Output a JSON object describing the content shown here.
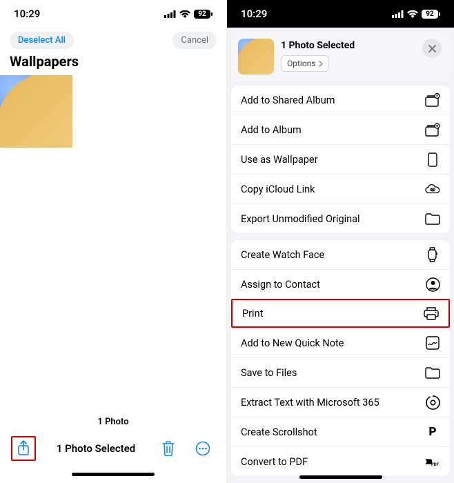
{
  "status": {
    "time": "10:29",
    "battery": "92"
  },
  "left": {
    "deselect": "Deselect All",
    "cancel": "Cancel",
    "title": "Wallpapers",
    "count": "1 Photo",
    "selected": "1 Photo Selected"
  },
  "right": {
    "title": "1 Photo Selected",
    "options": "Options",
    "group1": [
      {
        "label": "Add to Shared Album"
      },
      {
        "label": "Add to Album"
      },
      {
        "label": "Use as Wallpaper"
      },
      {
        "label": "Copy iCloud Link"
      },
      {
        "label": "Export Unmodified Original"
      }
    ],
    "group2": [
      {
        "label": "Create Watch Face"
      },
      {
        "label": "Assign to Contact"
      },
      {
        "label": "Print"
      },
      {
        "label": "Add to New Quick Note"
      },
      {
        "label": "Save to Files"
      },
      {
        "label": "Extract Text with Microsoft 365"
      },
      {
        "label": "Create Scrollshot"
      },
      {
        "label": "Convert to PDF"
      }
    ]
  }
}
